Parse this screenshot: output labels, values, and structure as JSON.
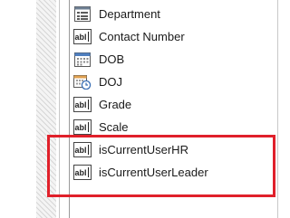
{
  "fields": [
    {
      "label": "Department",
      "icon": "list-field-icon"
    },
    {
      "label": "Contact Number",
      "icon": "text-field-icon"
    },
    {
      "label": "DOB",
      "icon": "date-field-icon"
    },
    {
      "label": "DOJ",
      "icon": "datetime-field-icon"
    },
    {
      "label": "Grade",
      "icon": "text-field-icon"
    },
    {
      "label": "Scale",
      "icon": "text-field-icon"
    },
    {
      "label": "isCurrentUserHR",
      "icon": "text-field-icon"
    },
    {
      "label": "isCurrentUserLeader",
      "icon": "text-field-icon"
    }
  ],
  "highlight_color": "#e0202a"
}
